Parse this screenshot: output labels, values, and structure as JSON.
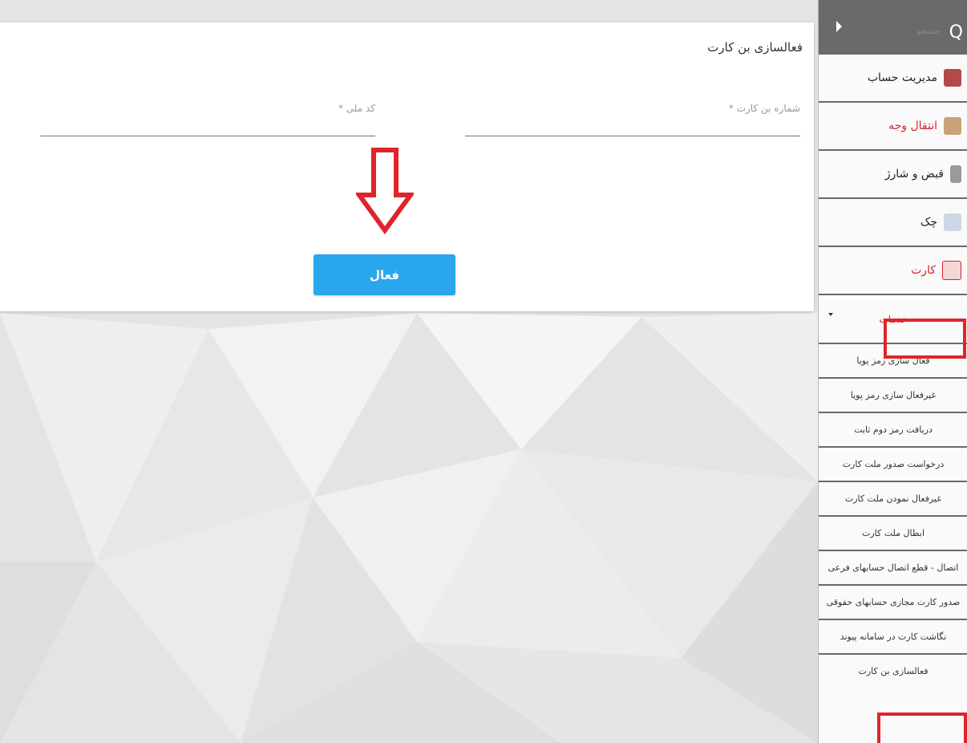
{
  "card": {
    "title": "فعالسازی بن کارت",
    "card_number_label": "شماره بن کارت *",
    "national_code_label": "کد ملی *",
    "card_number_value": "",
    "national_code_value": "",
    "activate_button": "فعال"
  },
  "sidebar": {
    "search_placeholder": "جستجو",
    "items": [
      {
        "label": "مدیریت حساب",
        "icon": "account-icon",
        "active": false
      },
      {
        "label": "انتقال وجه",
        "icon": "transfer-icon",
        "active": true
      },
      {
        "label": "قبض و شارژ",
        "icon": "bill-icon",
        "active": false
      },
      {
        "label": "چک",
        "icon": "cheque-icon",
        "active": false
      },
      {
        "label": "کارت",
        "icon": "card-icon",
        "active": true
      }
    ],
    "services_header": "خدمات",
    "services": [
      "فعال سازی رمز پویا",
      "غیرفعال سازی رمز پویا",
      "دریافت رمز دوم ثابت",
      "درخواست صدور ملت کارت",
      "غیرفعال نمودن ملت کارت",
      "ابطال ملت کارت",
      "اتصال - قطع اتصال حسابهای فرعی",
      "صدور کارت مجازی حسابهای حقوقی",
      "نگاشت کارت در سامانه پیوند",
      "فعالسازی بن کارت"
    ]
  },
  "colors": {
    "accent_button": "#2aa6ec",
    "highlight_red": "#e0242b",
    "sidebar_top": "#6a6a6a"
  }
}
